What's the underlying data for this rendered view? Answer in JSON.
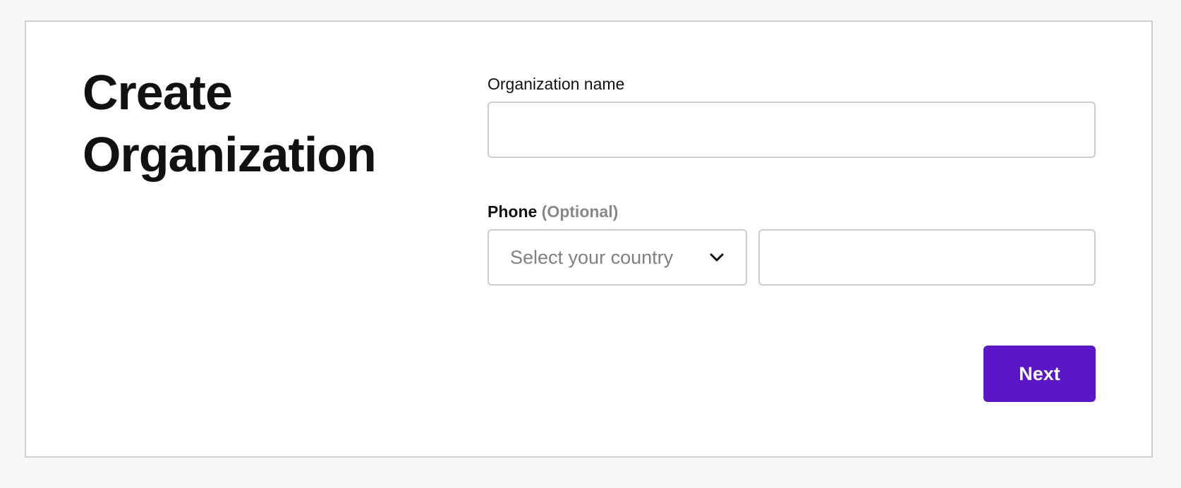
{
  "page": {
    "title": "Create Organization"
  },
  "form": {
    "org_name": {
      "label": "Organization name",
      "value": "",
      "placeholder": ""
    },
    "phone": {
      "label": "Phone",
      "optional_label": "(Optional)",
      "country_placeholder": "Select your country",
      "number_value": "",
      "number_placeholder": ""
    },
    "next_label": "Next"
  },
  "colors": {
    "accent": "#5b17c7",
    "border": "#cccccc",
    "background": "#f7f7f7"
  },
  "icons": {
    "country_dropdown": "chevron-down-icon"
  }
}
